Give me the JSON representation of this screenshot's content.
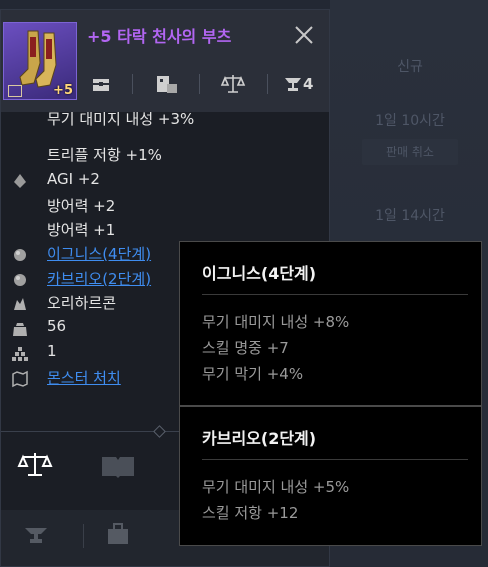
{
  "background": {
    "top_label": "",
    "cells": [
      {
        "text": "신규"
      },
      {
        "text": "1일 10시간"
      },
      {
        "text": "1일 14시간"
      }
    ],
    "cancel_button": "판매 취소"
  },
  "item": {
    "name": "+5 타락 천사의 부츠",
    "enhance": "+5",
    "header_icons": {
      "storage": "chest-icon",
      "trade": "scale-icon",
      "anvil_count": "4"
    },
    "stats_partial": "무기 대미지 내성 +3%",
    "stats": [
      {
        "text": "트리플 저항 +1%"
      },
      {
        "text": "AGI +2"
      },
      {
        "text": "방어력 +2"
      },
      {
        "text": "방어력 +1"
      }
    ],
    "set_links": [
      {
        "text": "이그니스(4단계)"
      },
      {
        "text": "카브리오(2단계)"
      }
    ],
    "material": "오리하르콘",
    "weight": "56",
    "stack": "1",
    "source_link": "몬스터 처치"
  },
  "set_tooltips": [
    {
      "title": "이그니스(4단계)",
      "effects": [
        "무기 대미지 내성 +8%",
        "스킬 명중 +7",
        "무기 막기 +4%"
      ]
    },
    {
      "title": "카브리오(2단계)",
      "effects": [
        "무기 대미지 내성 +5%",
        "스킬 저항 +12"
      ]
    }
  ],
  "colors": {
    "item_name": "#b266f2",
    "link": "#3f8df0",
    "enhance": "#ffd77a"
  }
}
